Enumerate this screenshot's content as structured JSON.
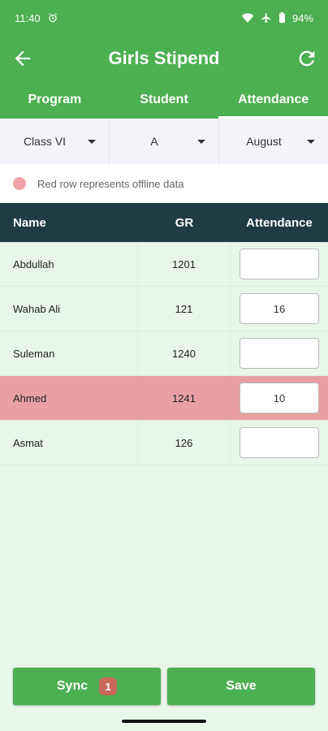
{
  "status_bar": {
    "time": "11:40",
    "battery": "94%",
    "icons": [
      "alarm-icon",
      "wifi-icon",
      "airplane-icon",
      "battery-icon"
    ]
  },
  "app_bar": {
    "title": "Girls Stipend",
    "back_icon": "arrow-back-icon",
    "refresh_icon": "refresh-icon"
  },
  "tabs": [
    {
      "label": "Program",
      "active": false
    },
    {
      "label": "Student",
      "active": false
    },
    {
      "label": "Attendance",
      "active": true
    }
  ],
  "filters": {
    "class": "Class VI",
    "section": "A",
    "month": "August"
  },
  "legend": {
    "text": "Red row represents offline data",
    "offline_color": "#e8a0a3"
  },
  "table": {
    "headers": [
      "Name",
      "GR",
      "Attendance"
    ],
    "rows": [
      {
        "name": "Abdullah",
        "gr": "1201",
        "attendance": "",
        "offline": false
      },
      {
        "name": "Wahab Ali",
        "gr": "121",
        "attendance": "16",
        "offline": false
      },
      {
        "name": "Suleman",
        "gr": "1240",
        "attendance": "",
        "offline": false
      },
      {
        "name": "Ahmed",
        "gr": "1241",
        "attendance": "10",
        "offline": true
      },
      {
        "name": "Asmat",
        "gr": "126",
        "attendance": "",
        "offline": false
      }
    ]
  },
  "footer": {
    "sync_label": "Sync",
    "sync_count": "1",
    "save_label": "Save"
  },
  "colors": {
    "primary": "#4caf50",
    "header_dark": "#1f3b43",
    "background": "#e8f5e9"
  }
}
